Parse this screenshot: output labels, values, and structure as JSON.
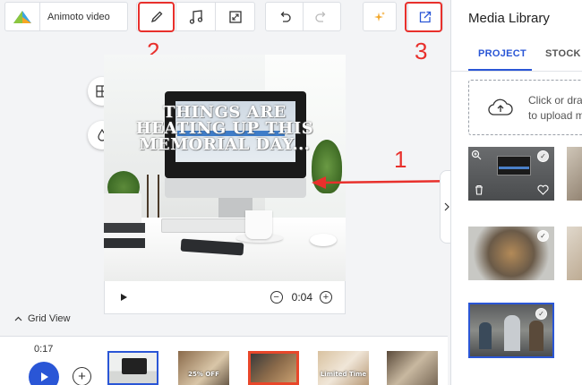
{
  "toolbar": {
    "project_name": "Animoto video",
    "icons": [
      "animoto-logo",
      "pencil-icon",
      "music-icon",
      "resize-icon",
      "undo-icon",
      "redo-icon",
      "sparkle-icon",
      "export-icon"
    ]
  },
  "annotations": {
    "label_1": "1",
    "label_2": "2",
    "label_3": "3",
    "highlight_color": "#e8302c"
  },
  "preview": {
    "overlay_lines": [
      "THINGS ARE",
      "HEATING UP THIS",
      "MEMORIAL DAY..."
    ],
    "time": "0:04"
  },
  "grid_view": {
    "label": "Grid View"
  },
  "timeline": {
    "total_time": "0:17",
    "thumb_captions": [
      "",
      "25% OFF",
      "",
      "Limited Time",
      ""
    ]
  },
  "library": {
    "title": "Media Library",
    "tabs": [
      {
        "label": "PROJECT",
        "active": true
      },
      {
        "label": "STOCK",
        "active": false
      }
    ],
    "upload_line1": "Click or dra",
    "upload_line2": "to upload m"
  },
  "colors": {
    "accent": "#2a56d6",
    "annotation": "#e8302c"
  }
}
